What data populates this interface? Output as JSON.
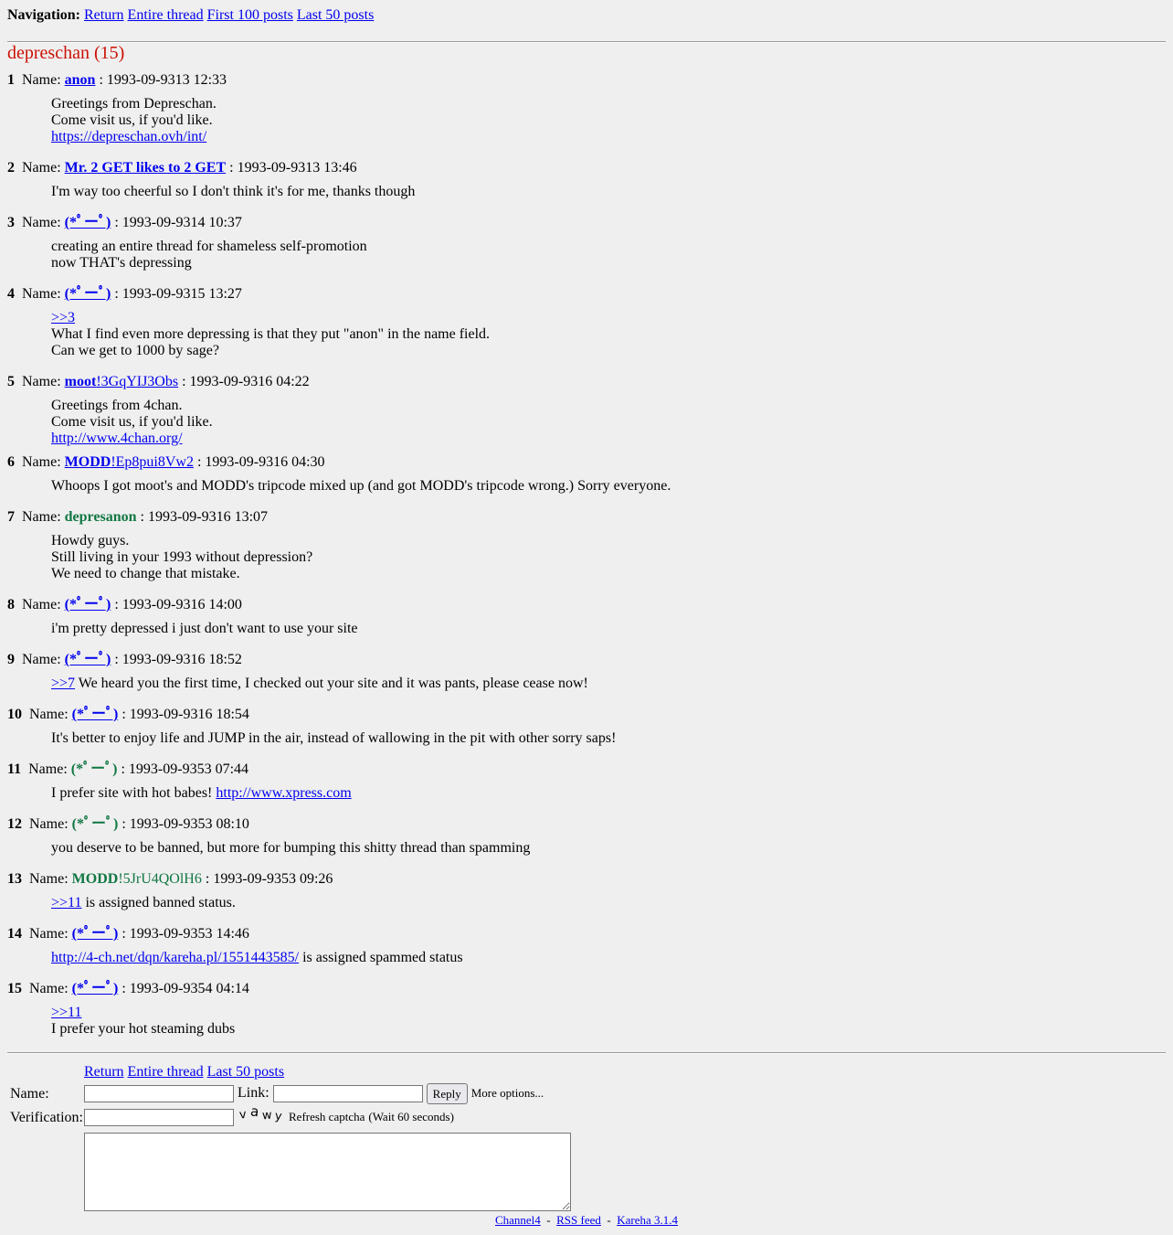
{
  "nav": {
    "label": "Navigation:",
    "links": [
      "Return",
      "Entire thread",
      "First 100 posts",
      "Last 50 posts"
    ]
  },
  "thread": {
    "title": "depreschan (15)"
  },
  "posts": [
    {
      "num": "1",
      "name_label": "Name:",
      "name": "anon",
      "trip": "",
      "date": "1993-09-9313 12:33",
      "lines": [
        "Greetings from Depreschan.",
        "Come visit us, if you'd like."
      ],
      "link": "https://depreschan.ovh/int/"
    },
    {
      "num": "2",
      "name_label": "Name:",
      "name": "Mr. 2 GET likes to 2 GET",
      "date": "1993-09-9313 13:46",
      "lines": [
        "I'm way too cheerful so I don't think it's for me, thanks though"
      ]
    },
    {
      "num": "3",
      "name_label": "Name:",
      "name": "(*ﾟーﾟ)",
      "date": "1993-09-9314 10:37",
      "lines": [
        "creating an entire thread for shameless self-promotion",
        "now THAT's depressing"
      ]
    },
    {
      "num": "4",
      "name_label": "Name:",
      "name": "(*ﾟーﾟ)",
      "date": "1993-09-9315 13:27",
      "quote": ">>3",
      "lines": [
        "What I find even more depressing is that they put \"anon\" in the name field.",
        "Can we get to 1000 by sage?"
      ]
    },
    {
      "num": "5",
      "name_label": "Name:",
      "name": "moot",
      "trip": "!3GqYIJ3Obs",
      "date": "1993-09-9316 04:22",
      "lines": [
        "Greetings from 4chan.",
        "Come visit us, if you'd like."
      ],
      "link": "http://www.4chan.org/"
    },
    {
      "num": "6",
      "name_label": "Name:",
      "name": "MODD",
      "trip": "!Ep8pui8Vw2",
      "date": "1993-09-9316 04:30",
      "lines": [
        "Whoops I got moot's and MODD's tripcode mixed up (and got MODD's tripcode wrong.) Sorry everyone."
      ]
    },
    {
      "num": "7",
      "name_label": "Name:",
      "name": "depresanon",
      "date": "1993-09-9316 13:07",
      "lines": [
        "Howdy guys.",
        "Still living in your 1993 without depression?",
        "We need to change that mistake."
      ]
    },
    {
      "num": "8",
      "name_label": "Name:",
      "name": "(*ﾟーﾟ)",
      "date": "1993-09-9316 14:00",
      "lines": [
        "i'm pretty depressed i just don't want to use your site"
      ]
    },
    {
      "num": "9",
      "name_label": "Name:",
      "name": "(*ﾟーﾟ)",
      "date": "1993-09-9316 18:52",
      "quote": ">>7",
      "quote_tail": " We heard you the first time, I checked out your site and it was pants, please cease now!"
    },
    {
      "num": "10",
      "name_label": "Name:",
      "name": "(*ﾟーﾟ)",
      "date": "1993-09-9316 18:54",
      "lines": [
        "It's better to enjoy life and JUMP in the air, instead of wallowing in the pit with other sorry saps!"
      ]
    },
    {
      "num": "11",
      "name_label": "Name:",
      "name": "(*ﾟーﾟ)",
      "date": "1993-09-9353 07:44",
      "text_before_link": "I prefer site with hot babes! ",
      "inline_link": "http://www.xpress.com"
    },
    {
      "num": "12",
      "name_label": "Name:",
      "name": "(*ﾟーﾟ)",
      "date": "1993-09-9353 08:10",
      "lines": [
        "you deserve to be banned, but more for bumping this shitty thread than spamming"
      ]
    },
    {
      "num": "13",
      "name_label": "Name:",
      "name": "MODD",
      "trip": "!5JrU4QOlH6",
      "date": "1993-09-9353 09:26",
      "quote": ">>11",
      "quote_tail": " is assigned banned status."
    },
    {
      "num": "14",
      "name_label": "Name:",
      "name": "(*ﾟーﾟ)",
      "date": "1993-09-9353 14:46",
      "quote": "http://4-ch.net/dqn/kareha.pl/1551443585/",
      "quote_tail": " is assigned spammed status"
    },
    {
      "num": "15",
      "name_label": "Name:",
      "name": "(*ﾟーﾟ)",
      "date": "1993-09-9354 04:14",
      "quote": ">>11",
      "lines": [
        "I prefer your hot steaming dubs"
      ]
    }
  ],
  "form": {
    "links": [
      "Return",
      "Entire thread",
      "Last 50 posts"
    ],
    "name_label": "Name:",
    "link_label": "Link:",
    "reply_button": "Reply",
    "more_options": "More options...",
    "verification_label": "Verification:",
    "captcha_text": "vawy",
    "refresh_captcha": "Refresh captcha",
    "wait_text": "(Wait 60 seconds)",
    "name_value": "",
    "link_value": "",
    "verification_value": ""
  },
  "footer": {
    "links": [
      "Channel4",
      "RSS feed",
      "Kareha 3.1.4"
    ],
    "separator": "-"
  },
  "colors": {
    "background": "#efefef",
    "title": "#cc1105",
    "link": "#0000ee",
    "green_name": "#117743"
  }
}
